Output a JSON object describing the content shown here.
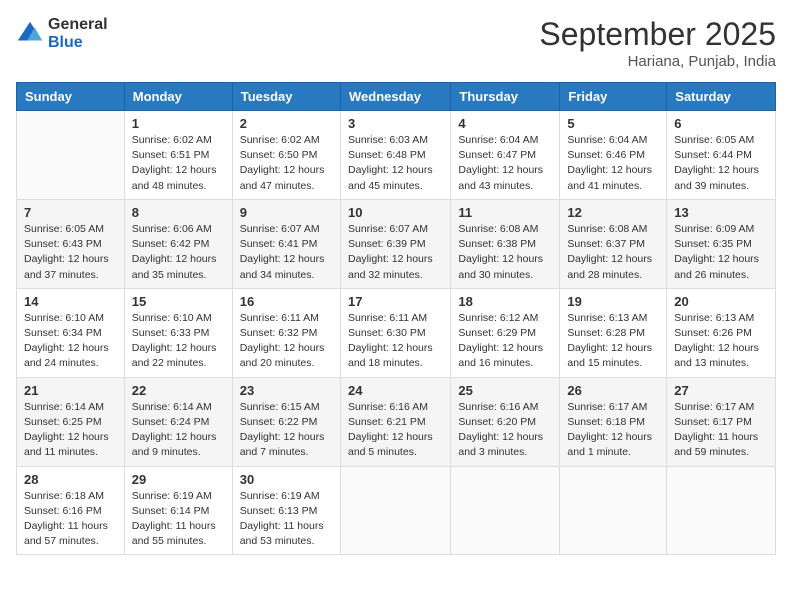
{
  "logo": {
    "general": "General",
    "blue": "Blue"
  },
  "title": "September 2025",
  "location": "Hariana, Punjab, India",
  "days_of_week": [
    "Sunday",
    "Monday",
    "Tuesday",
    "Wednesday",
    "Thursday",
    "Friday",
    "Saturday"
  ],
  "weeks": [
    [
      {
        "day": "",
        "info": ""
      },
      {
        "day": "1",
        "info": "Sunrise: 6:02 AM\nSunset: 6:51 PM\nDaylight: 12 hours\nand 48 minutes."
      },
      {
        "day": "2",
        "info": "Sunrise: 6:02 AM\nSunset: 6:50 PM\nDaylight: 12 hours\nand 47 minutes."
      },
      {
        "day": "3",
        "info": "Sunrise: 6:03 AM\nSunset: 6:48 PM\nDaylight: 12 hours\nand 45 minutes."
      },
      {
        "day": "4",
        "info": "Sunrise: 6:04 AM\nSunset: 6:47 PM\nDaylight: 12 hours\nand 43 minutes."
      },
      {
        "day": "5",
        "info": "Sunrise: 6:04 AM\nSunset: 6:46 PM\nDaylight: 12 hours\nand 41 minutes."
      },
      {
        "day": "6",
        "info": "Sunrise: 6:05 AM\nSunset: 6:44 PM\nDaylight: 12 hours\nand 39 minutes."
      }
    ],
    [
      {
        "day": "7",
        "info": "Sunrise: 6:05 AM\nSunset: 6:43 PM\nDaylight: 12 hours\nand 37 minutes."
      },
      {
        "day": "8",
        "info": "Sunrise: 6:06 AM\nSunset: 6:42 PM\nDaylight: 12 hours\nand 35 minutes."
      },
      {
        "day": "9",
        "info": "Sunrise: 6:07 AM\nSunset: 6:41 PM\nDaylight: 12 hours\nand 34 minutes."
      },
      {
        "day": "10",
        "info": "Sunrise: 6:07 AM\nSunset: 6:39 PM\nDaylight: 12 hours\nand 32 minutes."
      },
      {
        "day": "11",
        "info": "Sunrise: 6:08 AM\nSunset: 6:38 PM\nDaylight: 12 hours\nand 30 minutes."
      },
      {
        "day": "12",
        "info": "Sunrise: 6:08 AM\nSunset: 6:37 PM\nDaylight: 12 hours\nand 28 minutes."
      },
      {
        "day": "13",
        "info": "Sunrise: 6:09 AM\nSunset: 6:35 PM\nDaylight: 12 hours\nand 26 minutes."
      }
    ],
    [
      {
        "day": "14",
        "info": "Sunrise: 6:10 AM\nSunset: 6:34 PM\nDaylight: 12 hours\nand 24 minutes."
      },
      {
        "day": "15",
        "info": "Sunrise: 6:10 AM\nSunset: 6:33 PM\nDaylight: 12 hours\nand 22 minutes."
      },
      {
        "day": "16",
        "info": "Sunrise: 6:11 AM\nSunset: 6:32 PM\nDaylight: 12 hours\nand 20 minutes."
      },
      {
        "day": "17",
        "info": "Sunrise: 6:11 AM\nSunset: 6:30 PM\nDaylight: 12 hours\nand 18 minutes."
      },
      {
        "day": "18",
        "info": "Sunrise: 6:12 AM\nSunset: 6:29 PM\nDaylight: 12 hours\nand 16 minutes."
      },
      {
        "day": "19",
        "info": "Sunrise: 6:13 AM\nSunset: 6:28 PM\nDaylight: 12 hours\nand 15 minutes."
      },
      {
        "day": "20",
        "info": "Sunrise: 6:13 AM\nSunset: 6:26 PM\nDaylight: 12 hours\nand 13 minutes."
      }
    ],
    [
      {
        "day": "21",
        "info": "Sunrise: 6:14 AM\nSunset: 6:25 PM\nDaylight: 12 hours\nand 11 minutes."
      },
      {
        "day": "22",
        "info": "Sunrise: 6:14 AM\nSunset: 6:24 PM\nDaylight: 12 hours\nand 9 minutes."
      },
      {
        "day": "23",
        "info": "Sunrise: 6:15 AM\nSunset: 6:22 PM\nDaylight: 12 hours\nand 7 minutes."
      },
      {
        "day": "24",
        "info": "Sunrise: 6:16 AM\nSunset: 6:21 PM\nDaylight: 12 hours\nand 5 minutes."
      },
      {
        "day": "25",
        "info": "Sunrise: 6:16 AM\nSunset: 6:20 PM\nDaylight: 12 hours\nand 3 minutes."
      },
      {
        "day": "26",
        "info": "Sunrise: 6:17 AM\nSunset: 6:18 PM\nDaylight: 12 hours\nand 1 minute."
      },
      {
        "day": "27",
        "info": "Sunrise: 6:17 AM\nSunset: 6:17 PM\nDaylight: 11 hours\nand 59 minutes."
      }
    ],
    [
      {
        "day": "28",
        "info": "Sunrise: 6:18 AM\nSunset: 6:16 PM\nDaylight: 11 hours\nand 57 minutes."
      },
      {
        "day": "29",
        "info": "Sunrise: 6:19 AM\nSunset: 6:14 PM\nDaylight: 11 hours\nand 55 minutes."
      },
      {
        "day": "30",
        "info": "Sunrise: 6:19 AM\nSunset: 6:13 PM\nDaylight: 11 hours\nand 53 minutes."
      },
      {
        "day": "",
        "info": ""
      },
      {
        "day": "",
        "info": ""
      },
      {
        "day": "",
        "info": ""
      },
      {
        "day": "",
        "info": ""
      }
    ]
  ]
}
